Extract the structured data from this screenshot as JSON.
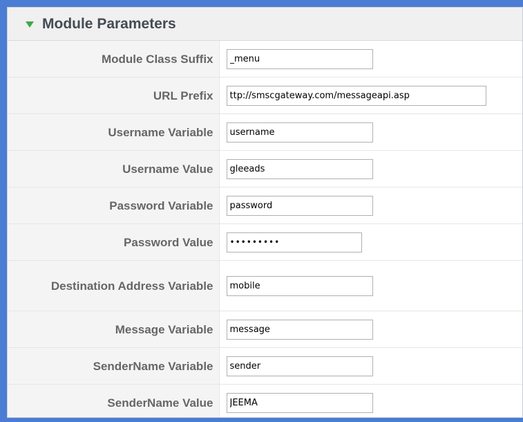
{
  "panel": {
    "title": "Module Parameters",
    "toggle_icon": "triangle-down-icon",
    "accent_color": "#3fa84a"
  },
  "fields": [
    {
      "label": "Module Class Suffix",
      "value": "_menu"
    },
    {
      "label": "URL Prefix",
      "value": "ttp://smscgateway.com/messageapi.asp"
    },
    {
      "label": "Username Variable",
      "value": "username"
    },
    {
      "label": "Username Value",
      "value": "gleeads"
    },
    {
      "label": "Password Variable",
      "value": "password"
    },
    {
      "label": "Password Value",
      "value": "•••••••••"
    },
    {
      "label": "Destination Address Variable",
      "value": "mobile"
    },
    {
      "label": "Message Variable",
      "value": "message"
    },
    {
      "label": "SenderName Variable",
      "value": "sender"
    },
    {
      "label": "SenderName Value",
      "value": "JEEMA"
    }
  ]
}
